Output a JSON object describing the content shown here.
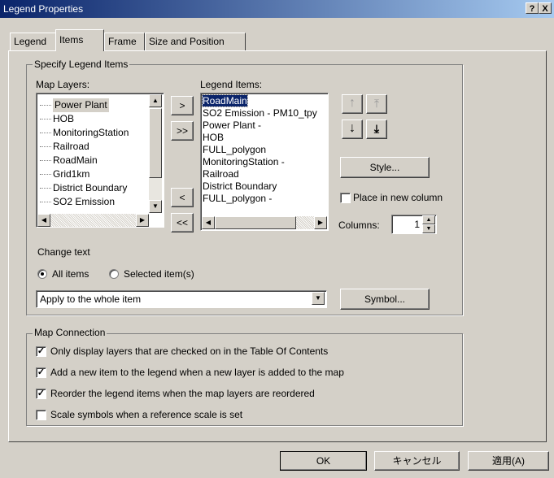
{
  "window": {
    "title": "Legend Properties",
    "help_btn": "?",
    "close_btn": "X"
  },
  "tabs": [
    {
      "label": "Legend"
    },
    {
      "label": "Items"
    },
    {
      "label": "Frame"
    },
    {
      "label": "Size and Position"
    }
  ],
  "specify": {
    "group_label": "Specify Legend Items",
    "map_layers_label": "Map Layers:",
    "map_layers": [
      "Power Plant",
      "HOB",
      "MonitoringStation",
      "Railroad",
      "RoadMain",
      "Grid1km",
      "District Boundary",
      "SO2 Emission"
    ],
    "legend_items_label": "Legend Items:",
    "legend_items": [
      "RoadMain",
      "SO2 Emission - PM10_tpy",
      "Power Plant -",
      "HOB",
      "FULL_polygon",
      "MonitoringStation -",
      "Railroad",
      "District Boundary",
      "FULL_polygon -"
    ],
    "btn_add": ">",
    "btn_add_all": ">>",
    "btn_remove": "<",
    "btn_remove_all": "<<",
    "style_btn": "Style...",
    "place_new_column": "Place in new column",
    "columns_label": "Columns:",
    "columns_value": "1",
    "change_text_label": "Change text",
    "radio_all": "All items",
    "radio_selected": "Selected item(s)",
    "apply_select_value": "Apply to the whole item",
    "symbol_btn": "Symbol..."
  },
  "map_connection": {
    "group_label": "Map Connection",
    "options": [
      {
        "label": "Only display layers that are checked on in the Table Of Contents",
        "checked": true
      },
      {
        "label": "Add a new item to the legend when a new layer is added to the map",
        "checked": true
      },
      {
        "label": "Reorder the legend items when the map layers are reordered",
        "checked": true
      },
      {
        "label": "Scale symbols when a reference scale is set",
        "checked": false
      }
    ]
  },
  "footer": {
    "ok": "OK",
    "cancel": "キャンセル",
    "apply": "適用(A)"
  },
  "colors": {
    "selection": "#0a246a",
    "titlebar": "#0a246a"
  }
}
